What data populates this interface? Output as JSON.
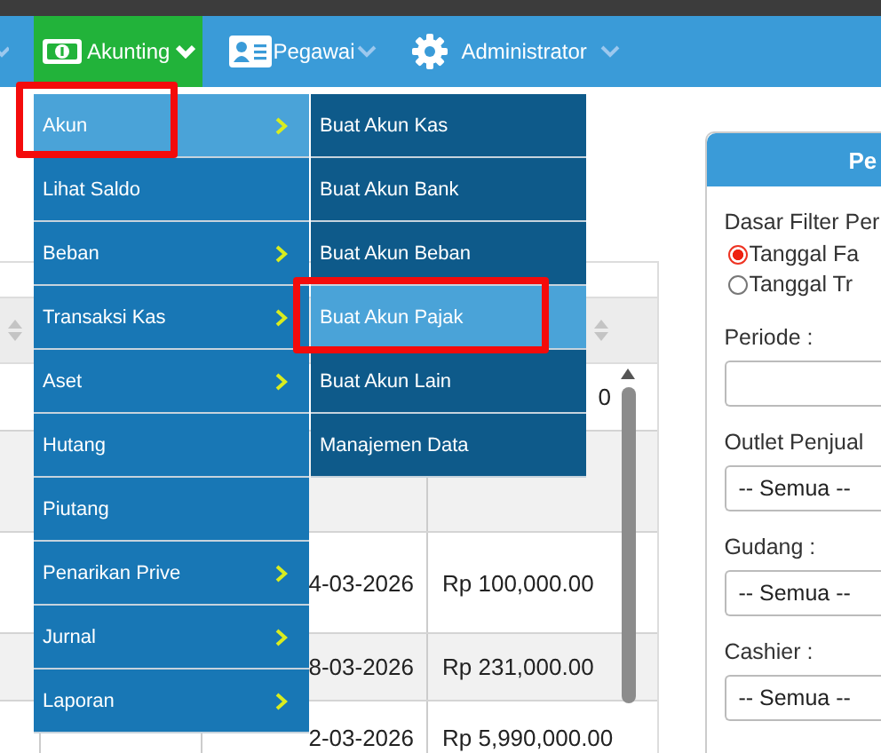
{
  "nav": {
    "items": [
      {
        "label": "Akunting",
        "active": true
      },
      {
        "label": "Pegawai",
        "active": false
      },
      {
        "label": "Administrator",
        "active": false
      }
    ]
  },
  "menu": {
    "items": [
      {
        "label": "Akun",
        "has_submenu": true,
        "selected": true,
        "annotated": true
      },
      {
        "label": "Lihat Saldo",
        "has_submenu": false,
        "selected": false,
        "annotated": false
      },
      {
        "label": "Beban",
        "has_submenu": true,
        "selected": false,
        "annotated": false
      },
      {
        "label": "Transaksi Kas",
        "has_submenu": true,
        "selected": false,
        "annotated": false
      },
      {
        "label": "Aset",
        "has_submenu": true,
        "selected": false,
        "annotated": false
      },
      {
        "label": "Hutang",
        "has_submenu": false,
        "selected": false,
        "annotated": false
      },
      {
        "label": "Piutang",
        "has_submenu": false,
        "selected": false,
        "annotated": false
      },
      {
        "label": "Penarikan Prive",
        "has_submenu": true,
        "selected": false,
        "annotated": false
      },
      {
        "label": "Jurnal",
        "has_submenu": true,
        "selected": false,
        "annotated": false
      },
      {
        "label": "Laporan",
        "has_submenu": true,
        "selected": false,
        "annotated": false
      }
    ]
  },
  "submenu": {
    "items": [
      {
        "label": "Buat Akun Kas",
        "selected": false,
        "annotated": false
      },
      {
        "label": "Buat Akun Bank",
        "selected": false,
        "annotated": false
      },
      {
        "label": "Buat Akun Beban",
        "selected": false,
        "annotated": false
      },
      {
        "label": "Buat Akun Pajak",
        "selected": true,
        "annotated": true
      },
      {
        "label": "Buat Akun Lain",
        "selected": false,
        "annotated": false
      },
      {
        "label": "Manajemen Data",
        "selected": false,
        "annotated": false
      }
    ]
  },
  "table": {
    "rows": [
      {
        "kind": "partial",
        "amount": "0"
      },
      {
        "kind": "blank"
      },
      {
        "kind": "data",
        "date": "4-03-2026",
        "amount": "Rp 100,000.00"
      },
      {
        "kind": "data",
        "date": "8-03-2026",
        "amount": "Rp 231,000.00"
      },
      {
        "kind": "data",
        "date": "2-03-2026",
        "amount": "Rp 5,990,000.00"
      }
    ]
  },
  "filter_panel": {
    "title": "Pe",
    "basis_label": "Dasar Filter Per",
    "options": [
      {
        "label": "Tanggal Fa",
        "selected": true
      },
      {
        "label": "Tanggal Tr",
        "selected": false
      }
    ],
    "fields": [
      {
        "label": "Periode :"
      },
      {
        "label": "Outlet Penjual",
        "value": "-- Semua --"
      },
      {
        "label": "Gudang :",
        "value": "-- Semua --"
      },
      {
        "label": "Cashier :",
        "value": "-- Semua --"
      }
    ]
  }
}
